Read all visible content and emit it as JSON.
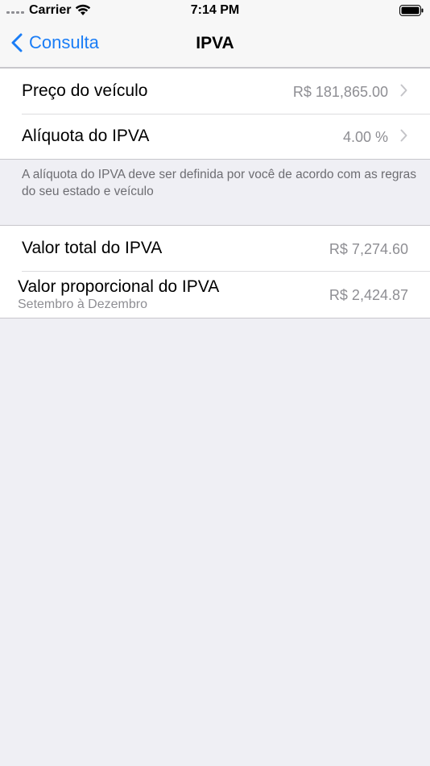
{
  "status_bar": {
    "carrier": "Carrier",
    "time": "7:14 PM"
  },
  "nav": {
    "back_label": "Consulta",
    "title": "IPVA"
  },
  "inputs": [
    {
      "label": "Preço do veículo",
      "value": "R$ 181,865.00"
    },
    {
      "label": "Alíquota do IPVA",
      "value": "4.00 %"
    }
  ],
  "note": "A alíquota do IPVA deve ser definida por você de acordo com as regras do seu estado e veículo",
  "results": {
    "total": {
      "label": "Valor total do IPVA",
      "value": "R$ 7,274.60"
    },
    "proportional": {
      "label": "Valor proporcional do IPVA",
      "subtitle": "Setembro à Dezembro",
      "value": "R$ 2,424.87"
    }
  },
  "colors": {
    "accent": "#1a7df6",
    "background": "#efeff4",
    "secondary_text": "#8e8e93"
  }
}
